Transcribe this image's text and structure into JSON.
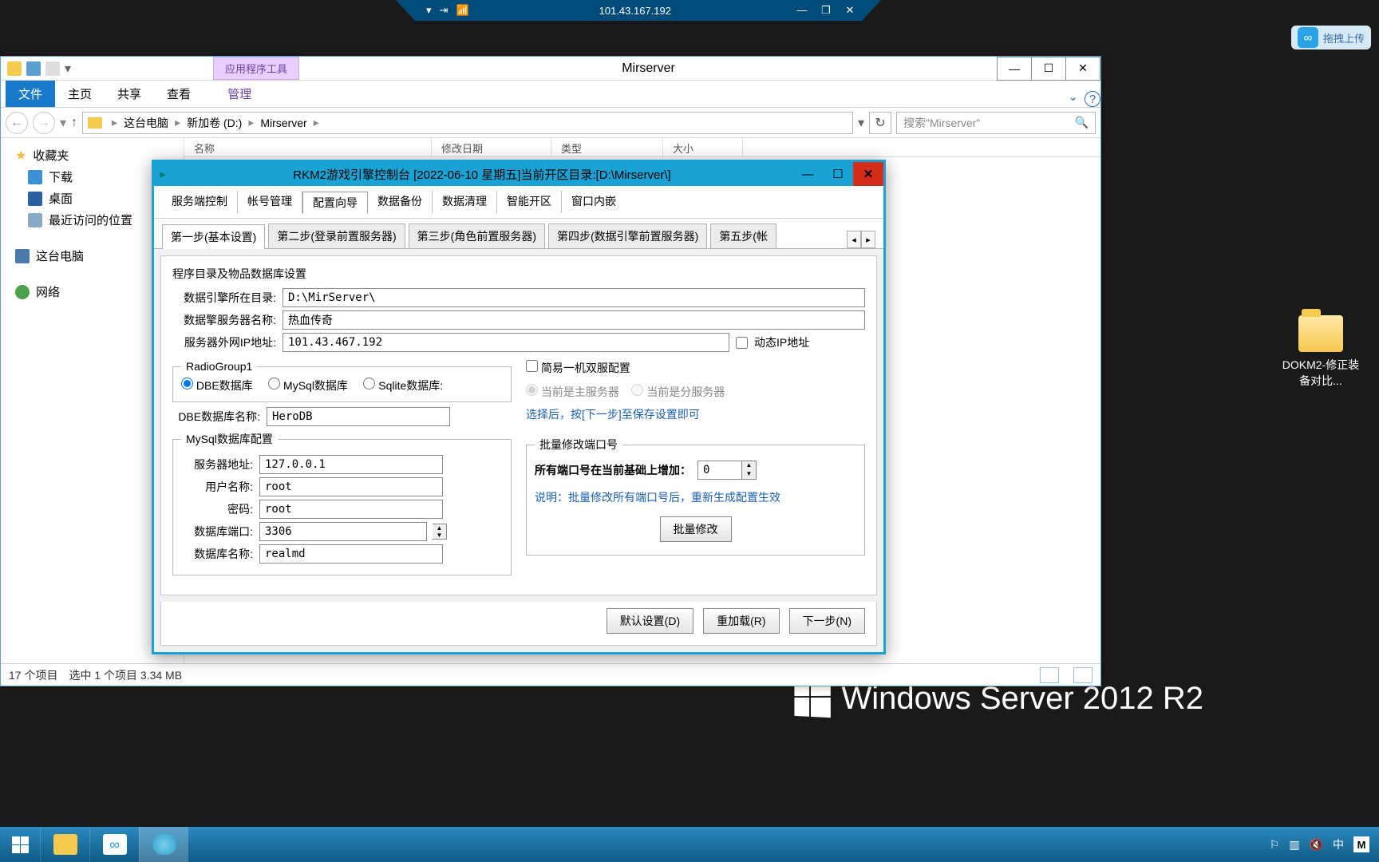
{
  "rdp": {
    "ip": "101.43.167.192"
  },
  "upload_pill": "拖拽上传",
  "desktop_icon_label": "DOKM2-修正装备对比...",
  "watermark": "Windows Server 2012 R2",
  "explorer": {
    "app_tools_tab": "应用程序工具",
    "title": "Mirserver",
    "ribbon": {
      "file": "文件",
      "home": "主页",
      "share": "共享",
      "view": "查看",
      "manage": "管理"
    },
    "breadcrumbs": [
      "这台电脑",
      "新加卷 (D:)",
      "Mirserver"
    ],
    "search_placeholder": "搜索\"Mirserver\"",
    "sidebar": {
      "favorites": "收藏夹",
      "downloads": "下载",
      "desktop": "桌面",
      "recent": "最近访问的位置",
      "this_pc": "这台电脑",
      "network": "网络"
    },
    "columns": [
      "名称",
      "修改日期",
      "类型",
      "大小"
    ],
    "status": {
      "items": "17 个项目",
      "selected": "选中 1 个项目 3.34 MB"
    }
  },
  "dialog": {
    "title": "RKM2游戏引擎控制台 [2022-06-10 星期五]当前开区目录:[D:\\Mirserver\\]",
    "menu": [
      "服务端控制",
      "帐号管理",
      "配置向导",
      "数据备份",
      "数据清理",
      "智能开区",
      "窗口内嵌"
    ],
    "menu_active_index": 2,
    "steps": [
      "第一步(基本设置)",
      "第二步(登录前置服务器)",
      "第三步(角色前置服务器)",
      "第四步(数据引擎前置服务器)",
      "第五步(帐"
    ],
    "section_title": "程序目录及物品数据库设置",
    "labels": {
      "engine_dir": "数据引擎所在目录:",
      "server_name": "数据擎服务器名称:",
      "wan_ip": "服务器外网IP地址:",
      "dyn_ip": "动态IP地址",
      "radio_group": "RadioGroup1",
      "dbe": "DBE数据库",
      "mysql": "MySql数据库",
      "sqlite": "Sqlite数据库:",
      "dbe_name": "DBE数据库名称:",
      "mysql_cfg": "MySql数据库配置",
      "srv_addr": "服务器地址:",
      "user": "用户名称:",
      "pwd": "密码:",
      "db_port": "数据库端口:",
      "db_name": "数据库名称:",
      "simple_dual": "简易一机双服配置",
      "is_master": "当前是主服务器",
      "is_slave": "当前是分服务器",
      "after_select": "选择后，按[下一步]至保存设置即可",
      "batch_title": "批量修改端口号",
      "batch_label": "所有端口号在当前基础上增加：",
      "batch_note": "说明：批量修改所有端口号后，重新生成配置生效",
      "batch_btn": "批量修改",
      "default_btn": "默认设置(D)",
      "reload_btn": "重加载(R)",
      "next_btn": "下一步(N)"
    },
    "values": {
      "engine_dir": "D:\\MirServer\\",
      "server_name": "热血传奇",
      "wan_ip": "101.43.467.192",
      "dbe_name": "HeroDB",
      "srv_addr": "127.0.0.1",
      "user": "root",
      "pwd": "root",
      "db_port": "3306",
      "db_name": "realmd",
      "port_offset": "0"
    }
  }
}
